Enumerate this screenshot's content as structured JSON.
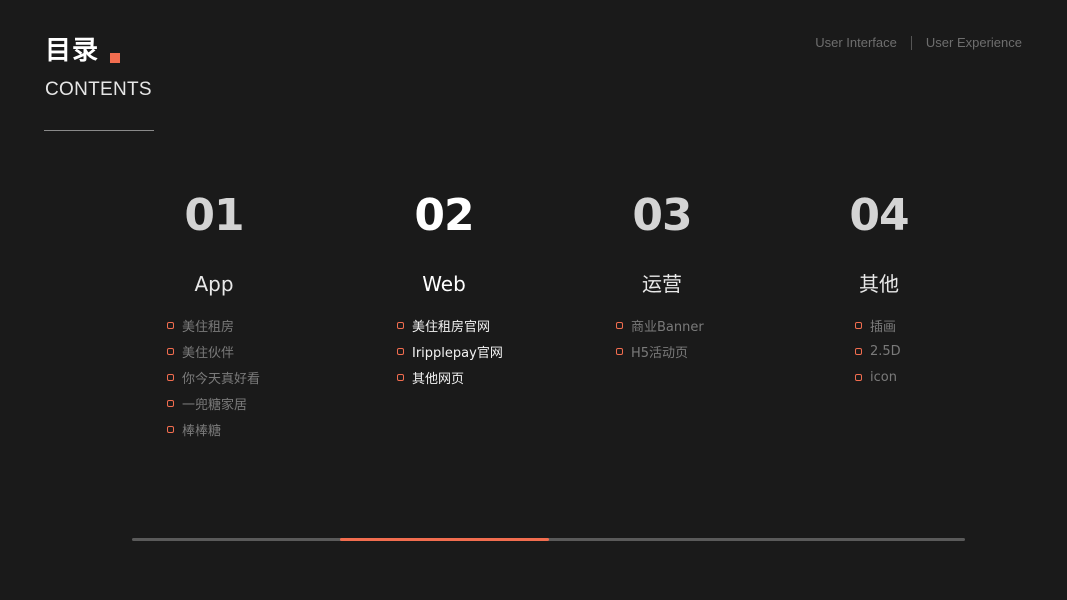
{
  "header": {
    "title_cn": "目录",
    "title_en": "CONTENTS",
    "accent_color": "#f26d4f"
  },
  "top_right": {
    "left_label": "User Interface",
    "right_label": "User Experience"
  },
  "sections": [
    {
      "number": "01",
      "title": "App",
      "items": [
        "美住租房",
        "美住伙伴",
        "你今天真好看",
        "一兜糖家居",
        "棒棒糖"
      ]
    },
    {
      "number": "02",
      "title": "Web",
      "items": [
        "美住租房官网",
        "Iripplepay官网",
        "其他网页"
      ]
    },
    {
      "number": "03",
      "title": "运营",
      "items": [
        "商业Banner",
        "H5活动页"
      ]
    },
    {
      "number": "04",
      "title": "其他",
      "items": [
        "插画",
        "2.5D",
        "icon"
      ]
    }
  ],
  "active_section": 2,
  "progress": {
    "segments_total": 4,
    "active_segment": 2
  }
}
